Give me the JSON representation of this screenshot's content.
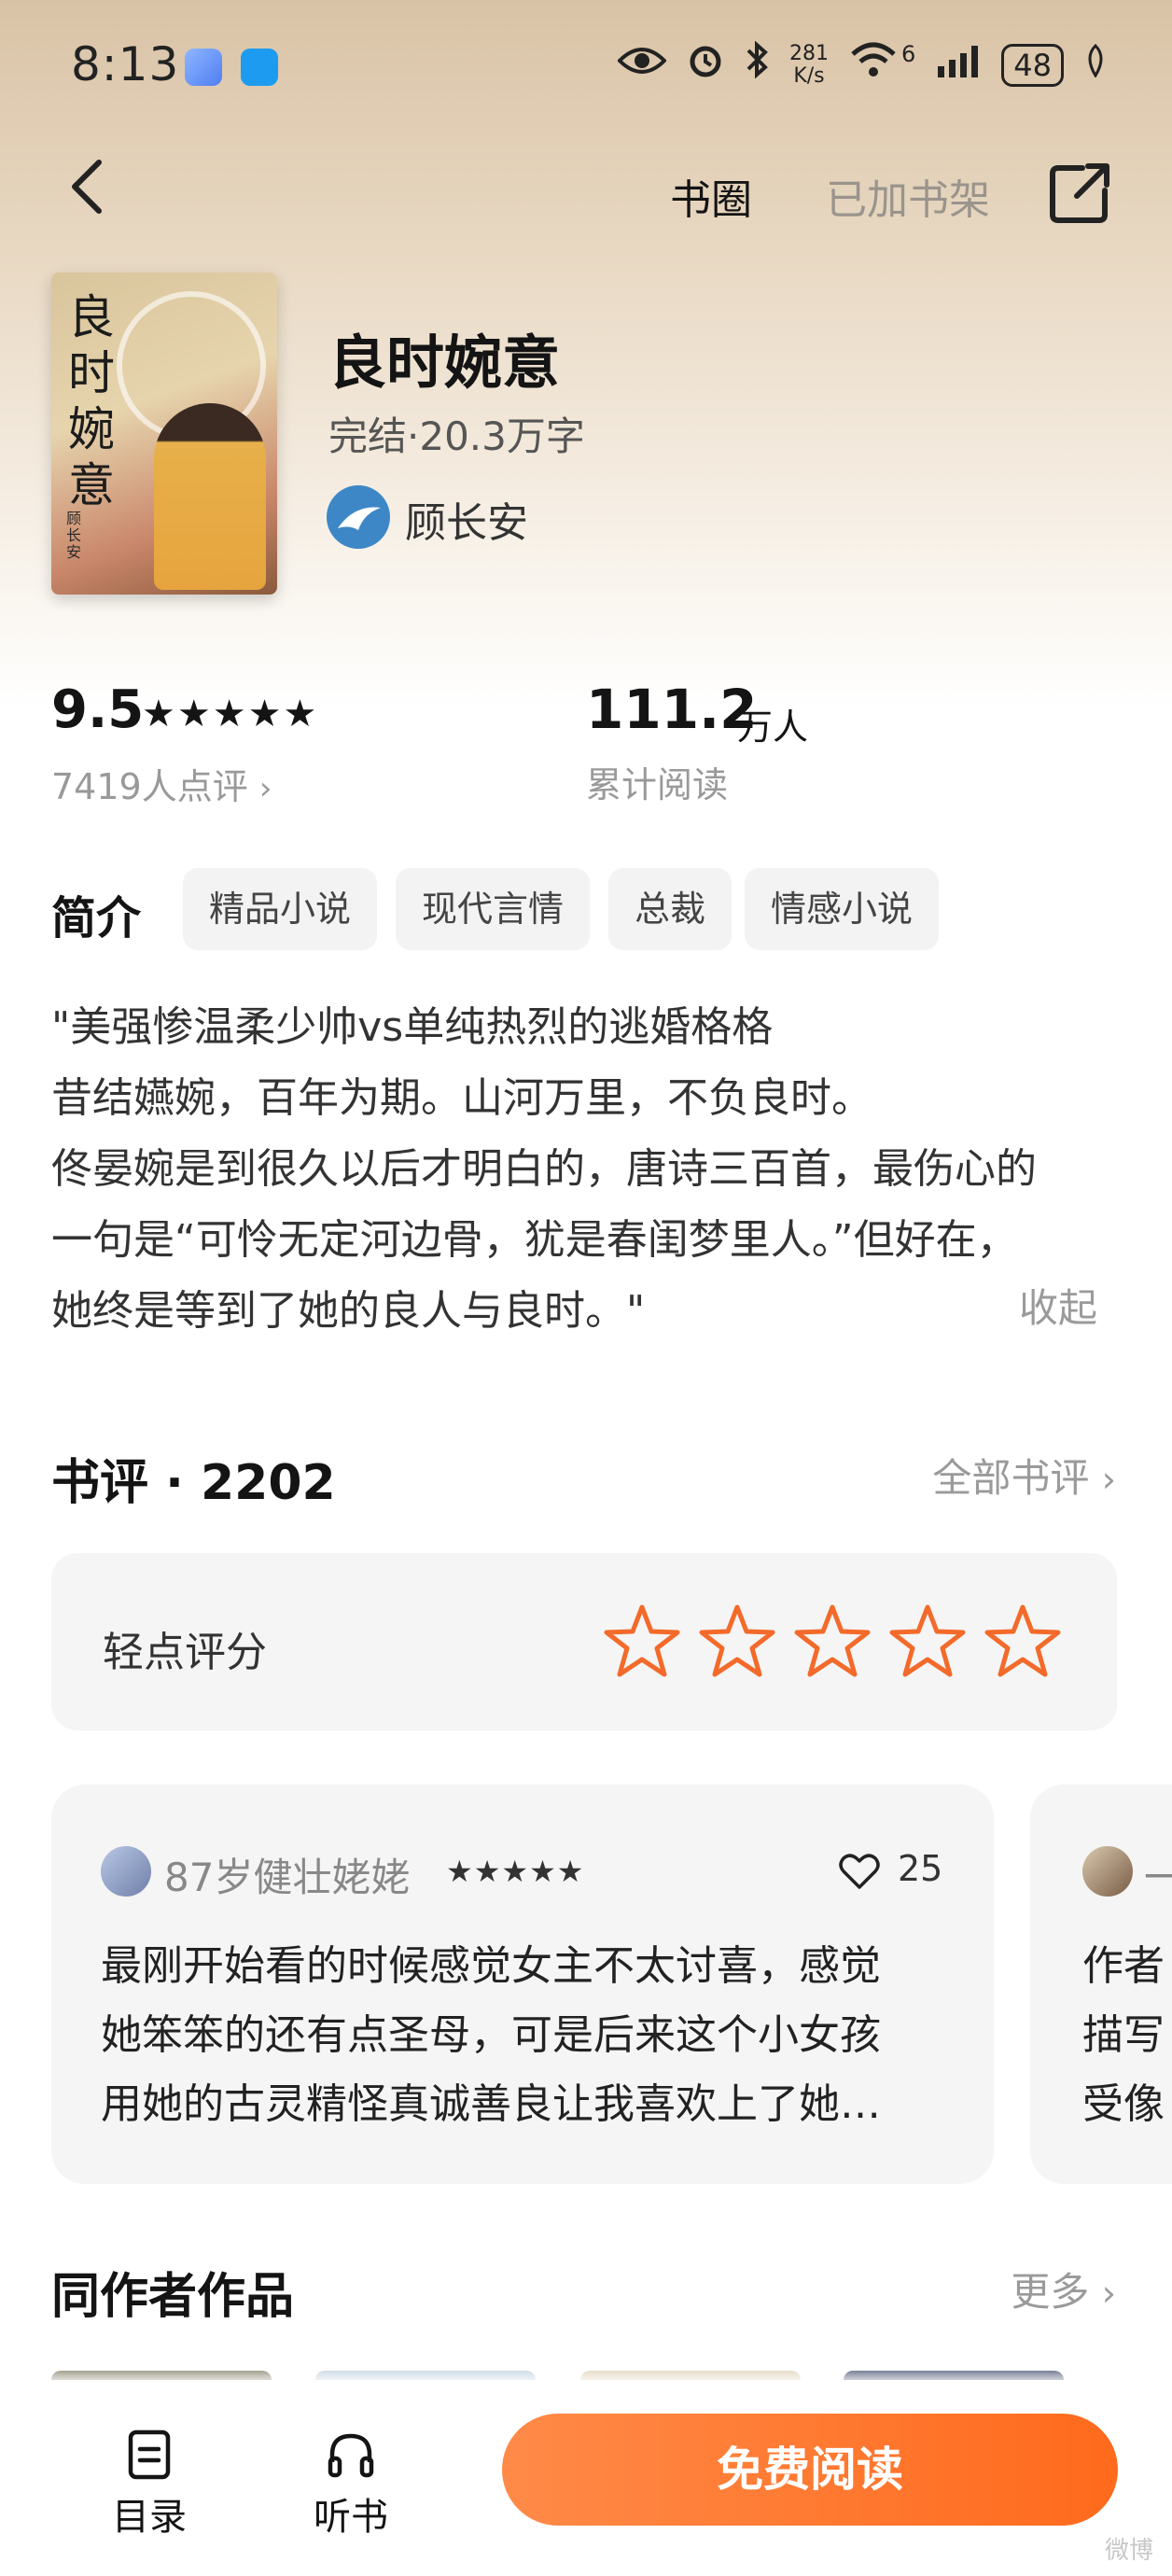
{
  "status_bar": {
    "time": "8:13",
    "net_speed_value": "281",
    "net_speed_unit": "K/s",
    "signal_label": "6",
    "battery": "48"
  },
  "nav": {
    "circle_label": "书圈",
    "shelf_label": "已加书架"
  },
  "book": {
    "title": "良时婉意",
    "meta": "完结·20.3万字",
    "author": "顾长安",
    "cover_title": "良时婉意",
    "cover_author": "顾长安"
  },
  "stats": {
    "score": "9.5",
    "stars": "★★★★★",
    "rating_count": "7419人点评",
    "reads_value": "111.2",
    "reads_unit": "万人",
    "reads_label": "累计阅读"
  },
  "intro": {
    "title": "简介",
    "tags": [
      "精品小说",
      "现代言情",
      "总裁",
      "情感小说"
    ],
    "lines": [
      "\"美强惨温柔少帅vs单纯热烈的逃婚格格",
      "昔结嬿婉，百年为期。山河万里，不负良时。",
      "佟晏婉是到很久以后才明白的，唐诗三百首，最伤心的",
      "一句是“可怜无定河边骨，犹是春闺梦里人。”但好在，",
      "她终是等到了她的良人与良时。\""
    ],
    "collapse": "收起"
  },
  "reviews": {
    "title": "书评 · 2202",
    "all_label": "全部书评",
    "rate_label": "轻点评分",
    "first": {
      "name": "87岁健壮姥姥",
      "stars": "★★★★★",
      "likes": "25",
      "lines": [
        "最刚开始看的时候感觉女主不太讨喜，感觉",
        "她笨笨的还有点圣母，可是后来这个小女孩",
        "用她的古灵精怪真诚善良让我喜欢上了她…"
      ]
    },
    "second": {
      "name": "一",
      "lines": [
        "作者",
        "描写",
        "受像"
      ]
    }
  },
  "same_author": {
    "title": "同作者作品",
    "more_label": "更多"
  },
  "bottom": {
    "toc_label": "目录",
    "listen_label": "听书",
    "read_label": "免费阅读"
  },
  "watermark": "微博"
}
